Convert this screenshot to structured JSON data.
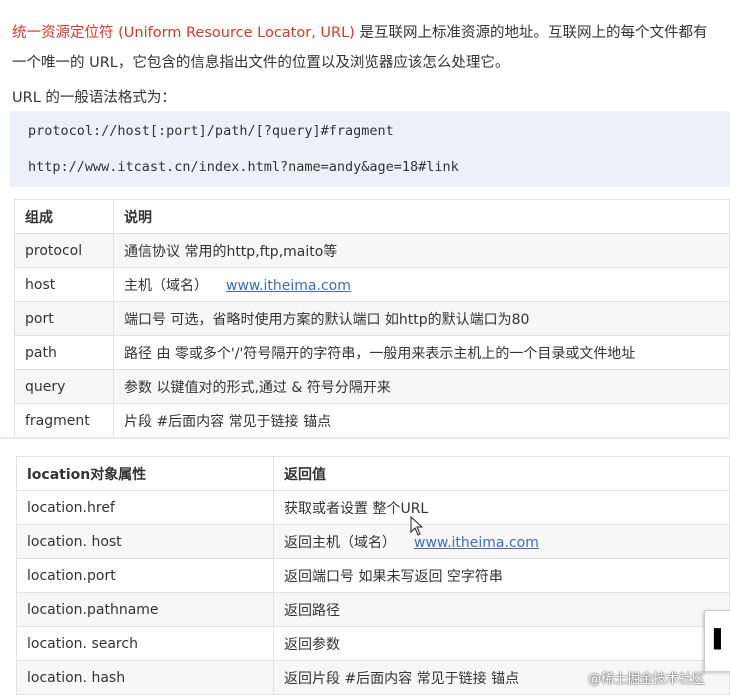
{
  "intro": {
    "term": "统一资源定位符 (Uniform Resource Locator, URL)",
    "line1_rest": " 是互联网上标准资源的地址。互联网上的每个文件都有",
    "line2": "一个唯一的 URL，它包含的信息指出文件的位置以及浏览器应该怎么处理它。"
  },
  "syntax_label": "URL 的一般语法格式为：",
  "code": {
    "line1": "protocol://host[:port]/path/[?query]#fragment",
    "line2": "http://www.itcast.cn/index.html?name=andy&age=18#link"
  },
  "table1": {
    "headers": [
      "组成",
      "说明"
    ],
    "rows": [
      [
        "protocol",
        "通信协议 常用的http,ftp,maito等"
      ],
      [
        "host",
        "主机（域名）"
      ],
      [
        "port",
        "端口号 可选，省略时使用方案的默认端口 如http的默认端口为80"
      ],
      [
        "path",
        "路径 由 零或多个'/'符号隔开的字符串，一般用来表示主机上的一个目录或文件地址"
      ],
      [
        "query",
        "参数  以键值对的形式,通过 & 符号分隔开来"
      ],
      [
        "fragment",
        "片段  #后面内容 常见于链接 锚点"
      ]
    ],
    "host_link": "www.itheima.com"
  },
  "table2": {
    "headers": [
      "location对象属性",
      "返回值"
    ],
    "rows": [
      [
        " location.href",
        "获取或者设置 整个URL"
      ],
      [
        "location. host",
        "返回主机（域名）"
      ],
      [
        "location.port",
        "返回端口号  如果未写返回 空字符串"
      ],
      [
        "location.pathname",
        "返回路径"
      ],
      [
        "location. search",
        "返回参数"
      ],
      [
        "location. hash",
        "返回片段   #后面内容 常见于链接 锚点"
      ]
    ],
    "host_link": "www.itheima.com"
  },
  "side_glyph": "▌",
  "watermark": "@稀土掘金技术社区",
  "icons": [
    "cursor-icon"
  ],
  "colors": {
    "accent_red": "#d23a2e",
    "link": "#3b6fb6",
    "code_bg": "#edf1f7"
  }
}
